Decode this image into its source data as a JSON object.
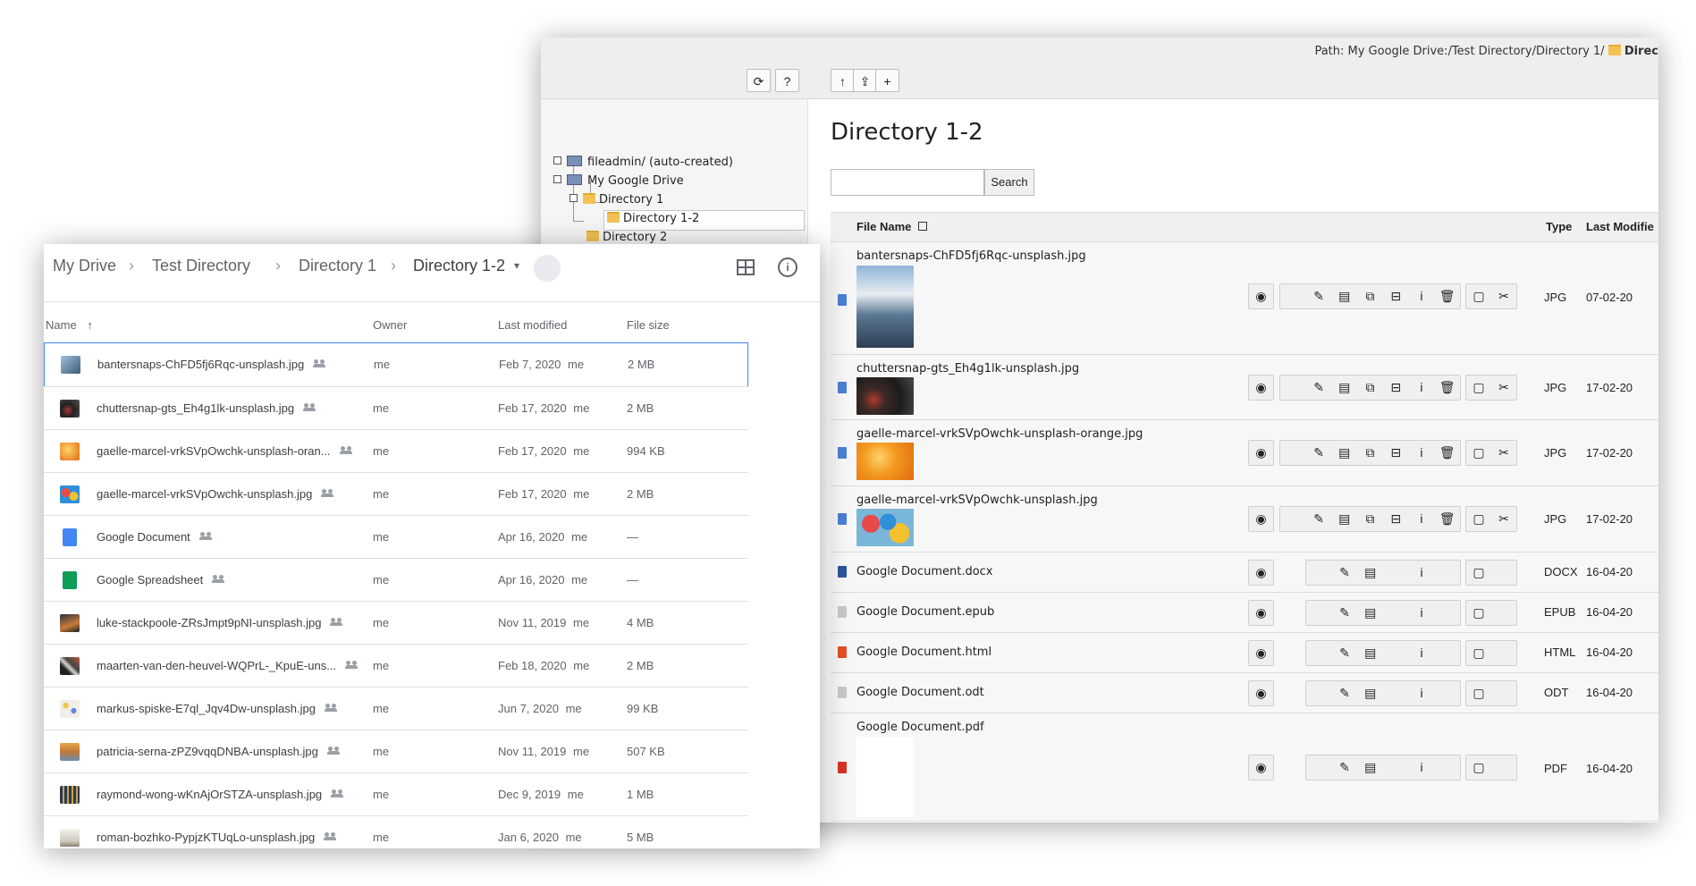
{
  "typo3": {
    "path_label": "Path: My Google Drive:/Test Directory/Directory 1/",
    "path_current": "Direc",
    "toolbar": {
      "refresh": "⟳",
      "help": "?",
      "up": "↑",
      "upload": "⇪",
      "new": "+"
    },
    "tree": [
      {
        "label": "fileadmin/ (auto-created)"
      },
      {
        "label": "My Google Drive"
      },
      {
        "label": "Directory 1"
      },
      {
        "label": "Directory 1-2"
      },
      {
        "label": "Directory 2"
      }
    ],
    "title": "Directory 1-2",
    "search_button": "Search",
    "columns": {
      "filename": "File Name",
      "type": "Type",
      "modified": "Last Modifie"
    },
    "files": [
      {
        "name": "bantersnaps-ChFD5fj6Rqc-unsplash.jpg",
        "type": "JPG",
        "date": "07-02-20"
      },
      {
        "name": "chuttersnap-gts_Eh4g1lk-unsplash.jpg",
        "type": "JPG",
        "date": "17-02-20"
      },
      {
        "name": "gaelle-marcel-vrkSVpOwchk-unsplash-orange.jpg",
        "type": "JPG",
        "date": "17-02-20"
      },
      {
        "name": "gaelle-marcel-vrkSVpOwchk-unsplash.jpg",
        "type": "JPG",
        "date": "17-02-20"
      },
      {
        "name": "Google Document.docx",
        "type": "DOCX",
        "date": "16-04-20"
      },
      {
        "name": "Google Document.epub",
        "type": "EPUB",
        "date": "16-04-20"
      },
      {
        "name": "Google Document.html",
        "type": "HTML",
        "date": "16-04-20"
      },
      {
        "name": "Google Document.odt",
        "type": "ODT",
        "date": "16-04-20"
      },
      {
        "name": "Google Document.pdf",
        "type": "PDF",
        "date": "16-04-20"
      }
    ],
    "action_icons": {
      "edit": "✎",
      "info": "i",
      "delete": "🗑",
      "copy": "▢",
      "cut": "✂"
    }
  },
  "drive": {
    "breadcrumb": [
      "My Drive",
      "Test Directory",
      "Directory 1",
      "Directory 1-2"
    ],
    "columns": {
      "name": "Name",
      "owner": "Owner",
      "modified": "Last modified",
      "size": "File size"
    },
    "files": [
      {
        "name": "bantersnaps-ChFD5fj6Rqc-unsplash.jpg",
        "owner": "me",
        "modified": "Feb 7, 2020",
        "by": "me",
        "size": "2 MB"
      },
      {
        "name": "chuttersnap-gts_Eh4g1lk-unsplash.jpg",
        "owner": "me",
        "modified": "Feb 17, 2020",
        "by": "me",
        "size": "2 MB"
      },
      {
        "name": "gaelle-marcel-vrkSVpOwchk-unsplash-oran...",
        "owner": "me",
        "modified": "Feb 17, 2020",
        "by": "me",
        "size": "994 KB"
      },
      {
        "name": "gaelle-marcel-vrkSVpOwchk-unsplash.jpg",
        "owner": "me",
        "modified": "Feb 17, 2020",
        "by": "me",
        "size": "2 MB"
      },
      {
        "name": "Google Document",
        "owner": "me",
        "modified": "Apr 16, 2020",
        "by": "me",
        "size": "—"
      },
      {
        "name": "Google Spreadsheet",
        "owner": "me",
        "modified": "Apr 16, 2020",
        "by": "me",
        "size": "—"
      },
      {
        "name": "luke-stackpoole-ZRsJmpt9pNI-unsplash.jpg",
        "owner": "me",
        "modified": "Nov 11, 2019",
        "by": "me",
        "size": "4 MB"
      },
      {
        "name": "maarten-van-den-heuvel-WQPrL-_KpuE-uns...",
        "owner": "me",
        "modified": "Feb 18, 2020",
        "by": "me",
        "size": "2 MB"
      },
      {
        "name": "markus-spiske-E7ql_Jqv4Dw-unsplash.jpg",
        "owner": "me",
        "modified": "Jun 7, 2020",
        "by": "me",
        "size": "99 KB"
      },
      {
        "name": "patricia-serna-zPZ9vqqDNBA-unsplash.jpg",
        "owner": "me",
        "modified": "Nov 11, 2019",
        "by": "me",
        "size": "507 KB"
      },
      {
        "name": "raymond-wong-wKnAjOrSTZA-unsplash.jpg",
        "owner": "me",
        "modified": "Dec 9, 2019",
        "by": "me",
        "size": "1 MB"
      },
      {
        "name": "roman-bozhko-PypjzKTUqLo-unsplash.jpg",
        "owner": "me",
        "modified": "Jan 6, 2020",
        "by": "me",
        "size": "5 MB"
      }
    ]
  }
}
